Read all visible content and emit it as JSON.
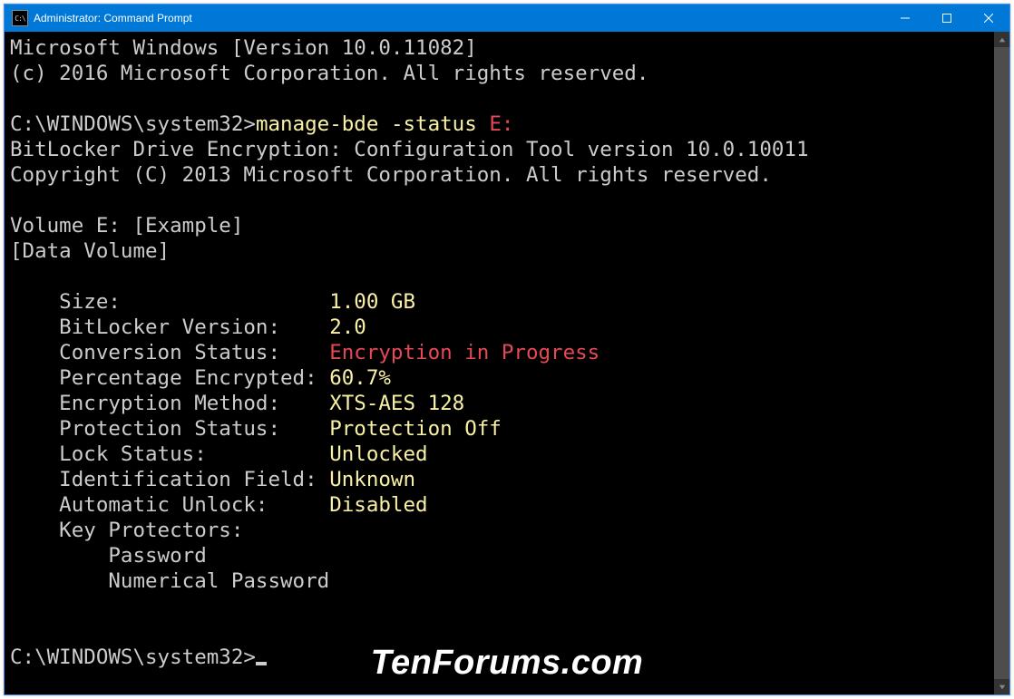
{
  "window": {
    "title": "Administrator: Command Prompt",
    "icon_label": "C:\\"
  },
  "terminal": {
    "header_line1": "Microsoft Windows [Version 10.0.11082]",
    "header_line2": "(c) 2016 Microsoft Corporation. All rights reserved.",
    "prompt_path": "C:\\WINDOWS\\system32>",
    "command": "manage-bde -status ",
    "command_arg": "E:",
    "tool_line1": "BitLocker Drive Encryption: Configuration Tool version 10.0.10011",
    "tool_line2": "Copyright (C) 2013 Microsoft Corporation. All rights reserved.",
    "volume_line": "Volume E: [Example]",
    "volume_type": "[Data Volume]",
    "fields": {
      "size_label": "    Size:                 ",
      "size_value": "1.00 GB",
      "version_label": "    BitLocker Version:    ",
      "version_value": "2.0",
      "conversion_label": "    Conversion Status:    ",
      "conversion_value": "Encryption in Progress",
      "percent_label": "    Percentage Encrypted: ",
      "percent_value": "60.7%",
      "method_label": "    Encryption Method:    ",
      "method_value": "XTS-AES 128",
      "protection_label": "    Protection Status:    ",
      "protection_value": "Protection Off",
      "lock_label": "    Lock Status:          ",
      "lock_value": "Unlocked",
      "ident_label": "    Identification Field: ",
      "ident_value": "Unknown",
      "auto_label": "    Automatic Unlock:     ",
      "auto_value": "Disabled",
      "keyprot_label": "    Key Protectors:",
      "keyprot_1": "        Password",
      "keyprot_2": "        Numerical Password"
    },
    "prompt2": "C:\\WINDOWS\\system32>"
  },
  "watermark": "TenForums.com"
}
